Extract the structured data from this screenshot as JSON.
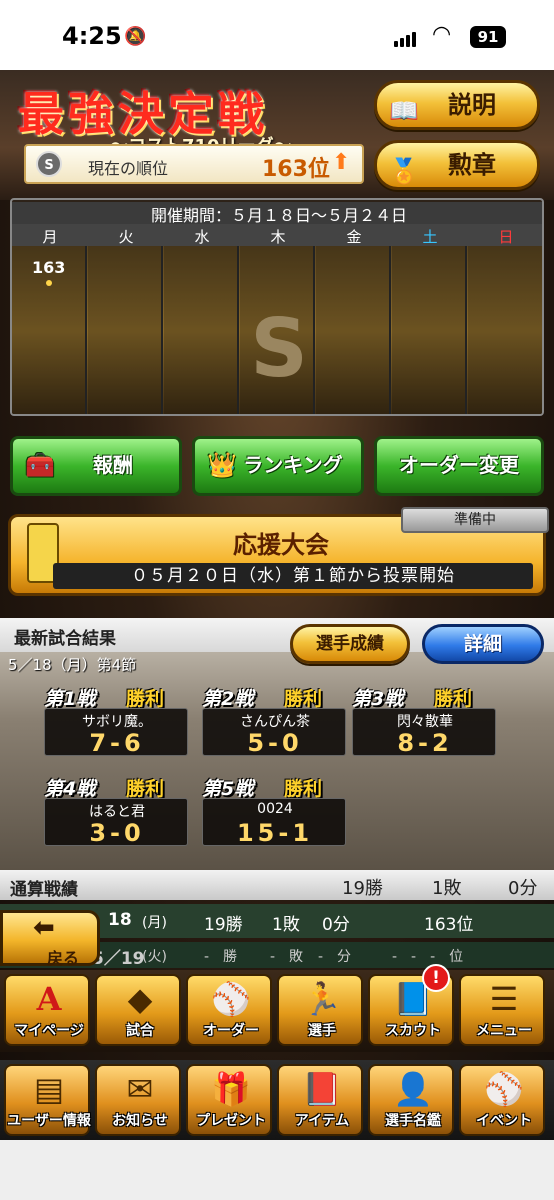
{
  "status": {
    "time": "4:25",
    "battery": "91"
  },
  "header": {
    "title": "最強決定戦",
    "subtitle": "〜コスト710リーグ〜",
    "rank_label": "現在の順位",
    "rank_value": "163位",
    "grade_icon": "S",
    "explain_button": "説明",
    "medal_button": "勲章"
  },
  "calendar": {
    "period": "開催期間：５月１８日〜５月２４日",
    "days": [
      "月",
      "火",
      "水",
      "木",
      "金",
      "土",
      "日"
    ],
    "day_colors": [
      "#ffffff",
      "#ffffff",
      "#ffffff",
      "#ffffff",
      "#ffffff",
      "#37c6ff",
      "#ff3b3b"
    ],
    "monday_rank": "163",
    "emblem": "S"
  },
  "actions": {
    "reward": "報酬",
    "ranking": "ランキング",
    "order": "オーダー変更"
  },
  "support": {
    "status": "準備中",
    "title": "応援大会",
    "info": "０５月２０日（水）第１節から投票開始"
  },
  "latest": {
    "title": "最新試合結果",
    "stats_button": "選手成績",
    "detail_button": "詳細",
    "date": "5／18（月）第4節",
    "games": [
      {
        "label": "第1戦",
        "result": "勝利",
        "opponent": "サボリ魔。",
        "score": "7-6"
      },
      {
        "label": "第2戦",
        "result": "勝利",
        "opponent": "さんぴん茶",
        "score": "5-0"
      },
      {
        "label": "第3戦",
        "result": "勝利",
        "opponent": "閃々散華",
        "score": "8-2"
      },
      {
        "label": "第4戦",
        "result": "勝利",
        "opponent": "はると君",
        "score": "3-0"
      },
      {
        "label": "第5戦",
        "result": "勝利",
        "opponent": "0024",
        "score": "15-1"
      }
    ]
  },
  "totals": {
    "title": "通算戦績",
    "wins": "19勝",
    "losses": "1敗",
    "draws": "0分"
  },
  "history": [
    {
      "day": "18",
      "dow": "(月)",
      "wins": "19勝",
      "losses": "1敗",
      "draws": "0分",
      "rank": "163位"
    },
    {
      "day": "5／19",
      "dow": "(火)",
      "wins": "-　勝",
      "losses": "-　敗",
      "draws": "-　分",
      "rank": "-　-　-　位"
    }
  ],
  "back": "戻る",
  "nav_main": [
    {
      "label": "マイページ",
      "icon": "A"
    },
    {
      "label": "試合",
      "icon": "◆"
    },
    {
      "label": "オーダー",
      "icon": "⚾"
    },
    {
      "label": "選手",
      "icon": "🏃"
    },
    {
      "label": "スカウト",
      "icon": "📘"
    },
    {
      "label": "メニュー",
      "icon": "☰"
    }
  ],
  "scout_badge": "!",
  "nav_sub": [
    {
      "label": "ユーザー情報",
      "icon": "▤"
    },
    {
      "label": "お知らせ",
      "icon": "✉"
    },
    {
      "label": "プレゼント",
      "icon": "🎁"
    },
    {
      "label": "アイテム",
      "icon": "📕"
    },
    {
      "label": "選手名鑑",
      "icon": "👤"
    },
    {
      "label": "イベント",
      "icon": "⚾"
    }
  ]
}
